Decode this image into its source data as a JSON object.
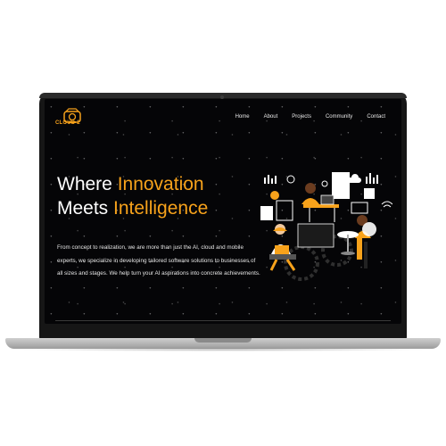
{
  "brand": {
    "name": "CLOUD 2",
    "color": "#f7a21b"
  },
  "nav": {
    "items": [
      {
        "label": "Home"
      },
      {
        "label": "About"
      },
      {
        "label": "Projects"
      },
      {
        "label": "Community"
      },
      {
        "label": "Contact"
      }
    ]
  },
  "hero": {
    "line1_prefix": "Where ",
    "line1_accent": "Innovation",
    "line2_prefix": "Meets ",
    "line2_accent": "Intelligence",
    "description": "From concept to realization, we are more than just the AI, cloud and mobile experts, we specialize in developing tailored software solutions to businesses of all sizes and stages. We help turn your AI aspirations into concrete achievements."
  },
  "colors": {
    "accent": "#f7a21b",
    "screen_bg": "#050507",
    "bezel": "#161616"
  },
  "icons": [
    "logo-icon",
    "team-collaboration-illustration"
  ]
}
